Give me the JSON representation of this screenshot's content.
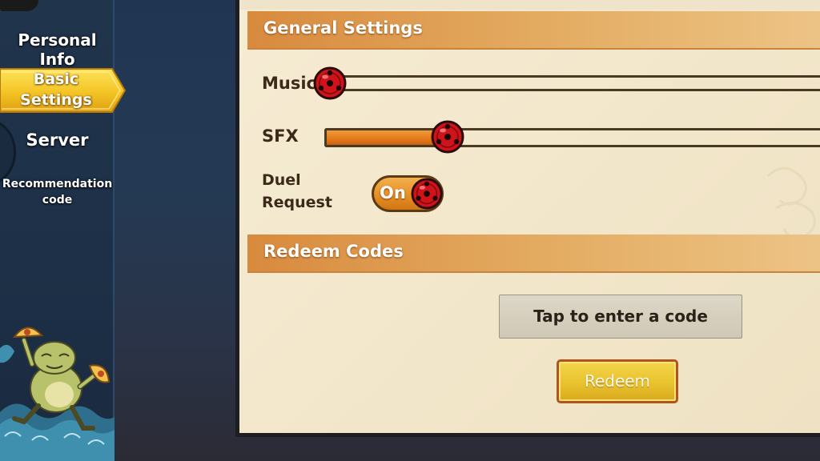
{
  "sidebar": {
    "items": [
      {
        "label": "Personal Info"
      },
      {
        "label_line1": "Basic",
        "label_line2": "Settings",
        "active": true
      },
      {
        "label": "Server"
      },
      {
        "label_line1": "Recommendation",
        "label_line2": "code"
      }
    ]
  },
  "settings": {
    "general_header": "General Settings",
    "music_label": "Music",
    "music_level": 0.0,
    "sfx_label": "SFX",
    "sfx_level": 0.24,
    "duel_label_line1": "Duel",
    "duel_label_line2": "Request",
    "duel_toggle_text": "On"
  },
  "redeem": {
    "header": "Redeem Codes",
    "code_placeholder": "Tap to enter a code",
    "button_label": "Redeem"
  },
  "colors": {
    "accent_orange": "#e4781b",
    "header_orange": "#d88a3e",
    "redeem_yellow": "#e9c22f",
    "knob_red": "#d0121b"
  },
  "icons": {
    "slider_knob": "sharingan-knob-icon",
    "frog": "frog-character-icon"
  }
}
